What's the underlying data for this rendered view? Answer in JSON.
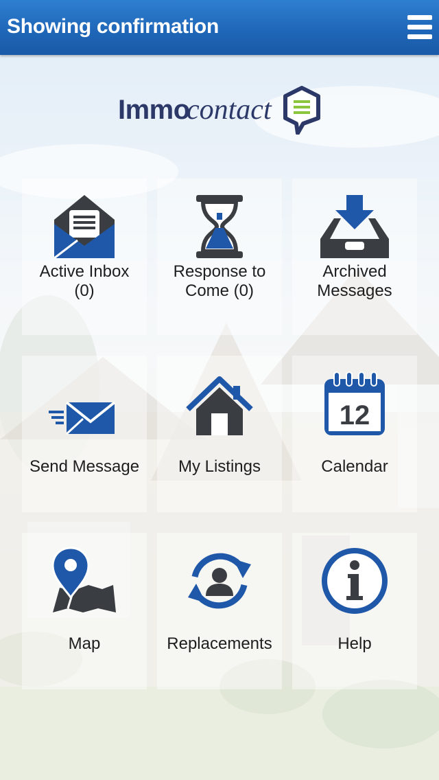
{
  "header": {
    "title": "Showing confirmation",
    "menu_icon": "hamburger-menu-icon"
  },
  "logo": {
    "word1": "Immo",
    "word2": "contact"
  },
  "colors": {
    "header_blue": "#1f67b9",
    "icon_blue": "#1f58a8",
    "icon_dark": "#3a3d42",
    "logo_navy": "#2c3868",
    "logo_green": "#8cc63f"
  },
  "tiles": [
    {
      "label_line1": "Active Inbox",
      "label_line2": "(0)",
      "icon": "envelope-open-icon"
    },
    {
      "label_line1": "Response to",
      "label_line2": "Come (0)",
      "icon": "hourglass-icon"
    },
    {
      "label_line1": "Archived",
      "label_line2": "Messages",
      "icon": "archive-tray-icon"
    },
    {
      "label": "Send Message",
      "icon": "send-envelope-icon"
    },
    {
      "label": "My Listings",
      "icon": "house-icon"
    },
    {
      "label": "Calendar",
      "icon": "calendar-icon",
      "day": "12"
    },
    {
      "label": "Map",
      "icon": "map-pin-icon"
    },
    {
      "label": "Replacements",
      "icon": "person-swap-icon"
    },
    {
      "label": "Help",
      "icon": "info-icon"
    }
  ]
}
